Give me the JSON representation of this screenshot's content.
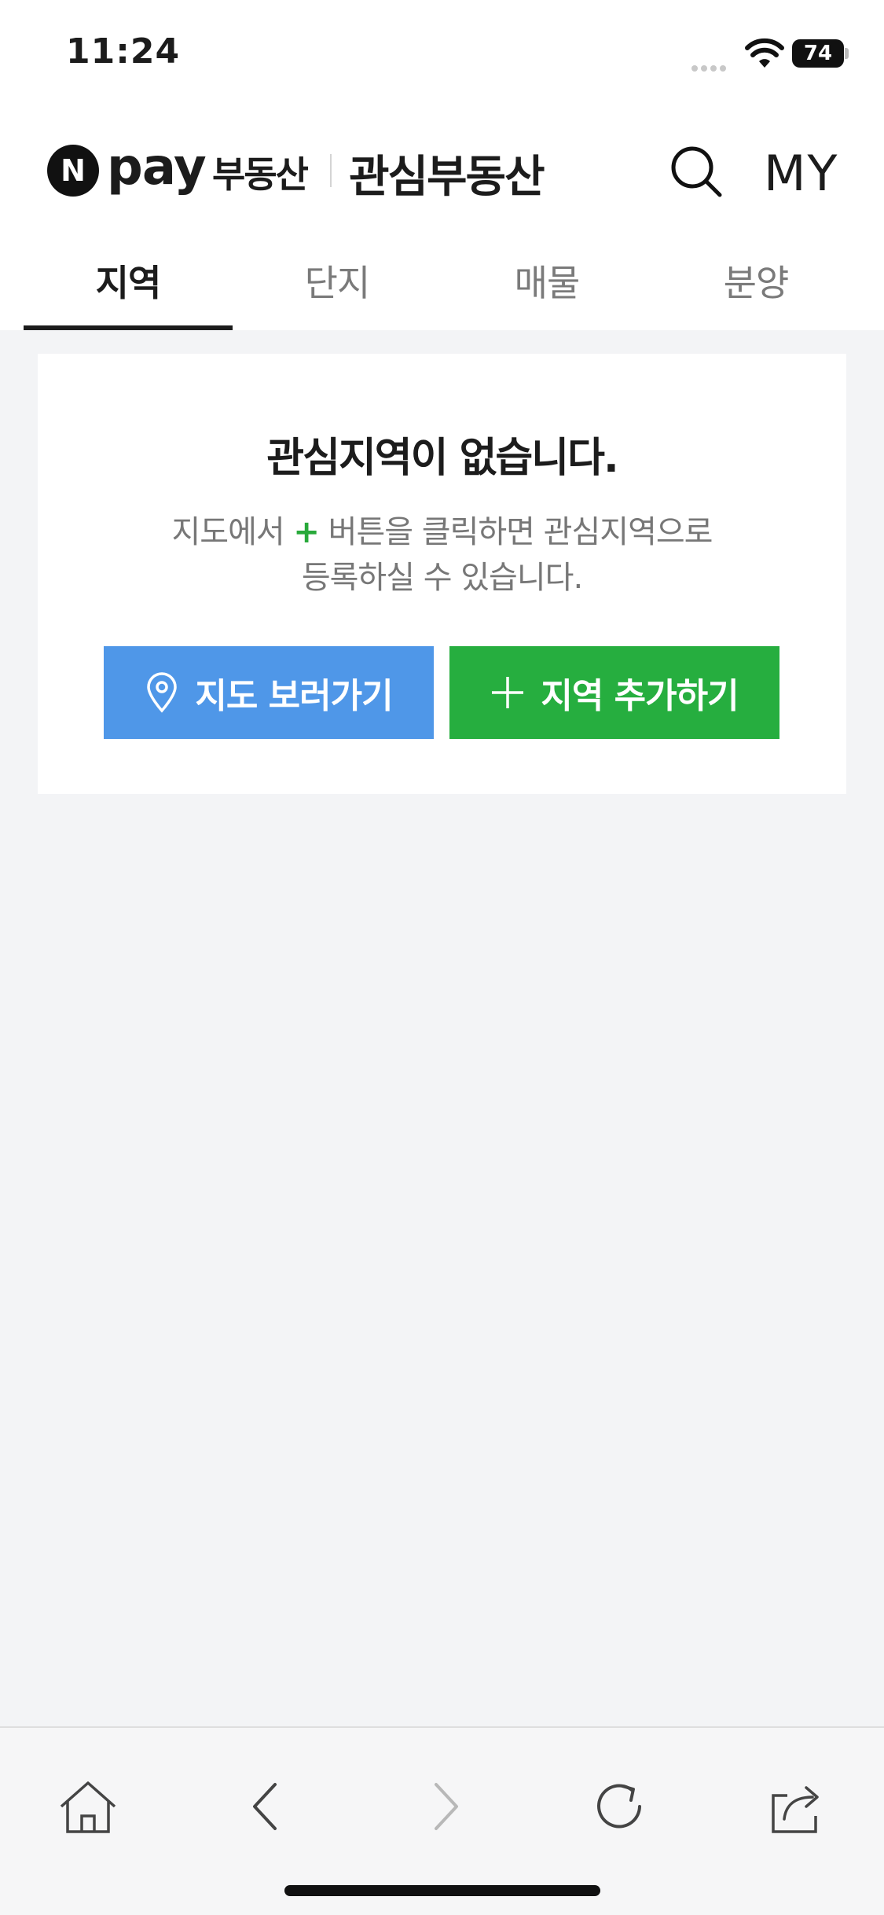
{
  "status_bar": {
    "time": "11:24",
    "battery": "74"
  },
  "header": {
    "logo_mark": "N",
    "logo_pay": "pay",
    "logo_service": "부동산",
    "title": "관심부동산",
    "my_label": "MY",
    "icons": [
      "search-icon"
    ]
  },
  "tabs": [
    {
      "label": "지역",
      "active": true
    },
    {
      "label": "단지",
      "active": false
    },
    {
      "label": "매물",
      "active": false
    },
    {
      "label": "분양",
      "active": false
    }
  ],
  "empty_state": {
    "title": "관심지역이 없습니다.",
    "desc_before": "지도에서",
    "desc_plus": "+",
    "desc_after": "버튼을 클릭하면 관심지역으로",
    "desc_line2": "등록하실 수 있습니다.",
    "map_button": "지도 보러가기",
    "add_button": "지역 추가하기"
  },
  "colors": {
    "map_button": "#4f97e8",
    "add_button": "#26ae3f",
    "plus_accent": "#28a93a",
    "background": "#f3f4f6"
  },
  "toolbar": {
    "icons": [
      "home-icon",
      "back-icon",
      "forward-icon",
      "refresh-icon",
      "share-icon"
    ]
  }
}
